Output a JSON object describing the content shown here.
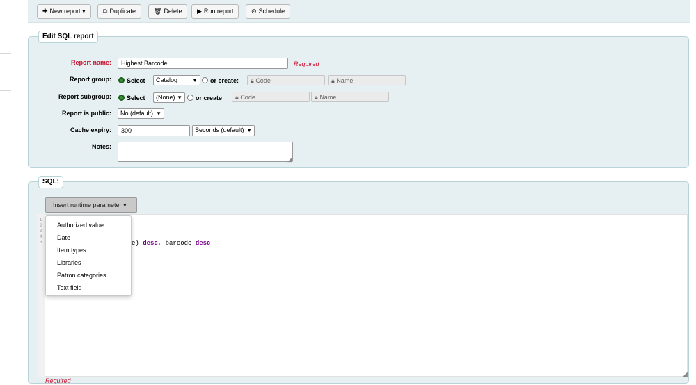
{
  "toolbar": {
    "new_report": "New report",
    "duplicate": "Duplicate",
    "delete": "Delete",
    "run_report": "Run report",
    "schedule": "Schedule"
  },
  "edit_section": {
    "legend": "Edit SQL report",
    "report_name_label": "Report name:",
    "report_name_value": "Highest Barcode",
    "required_text": "Required",
    "report_group_label": "Report group:",
    "select_text": "Select",
    "group_selected": "Catalog",
    "or_create_colon": "or create:",
    "code_placeholder": "Code",
    "name_placeholder": "Name",
    "report_subgroup_label": "Report subgroup:",
    "subgroup_selected": "(None)",
    "or_create": "or create",
    "public_label": "Report is public:",
    "public_selected": "No (default)",
    "cache_label": "Cache expiry:",
    "cache_value": "300",
    "cache_unit": "Seconds (default)",
    "notes_label": "Notes:",
    "notes_value": ""
  },
  "sql_section": {
    "legend": "SQL:",
    "insert_param_button": "Insert runtime parameter",
    "line_numbers": [
      "1",
      "2",
      "3",
      "4",
      "5"
    ],
    "code_line4_visible_prefix": "e) ",
    "code_kw1": "desc",
    "code_mid": ", barcode ",
    "code_kw2": "desc",
    "required_text": "Required"
  },
  "runtime_menu": {
    "items": [
      "Authorized value",
      "Date",
      "Item types",
      "Libraries",
      "Patron categories",
      "Text field"
    ]
  },
  "colors": {
    "panel_bg": "#e6f0f2",
    "required_red": "#c8102e",
    "radio_green": "#3b8f3b",
    "sql_keyword": "#770088"
  },
  "icons": {
    "new_report": "plus-icon",
    "duplicate": "copy-icon",
    "delete": "trash-icon",
    "run_report": "play-icon",
    "schedule": "clock-icon",
    "lock": "lock-icon"
  }
}
